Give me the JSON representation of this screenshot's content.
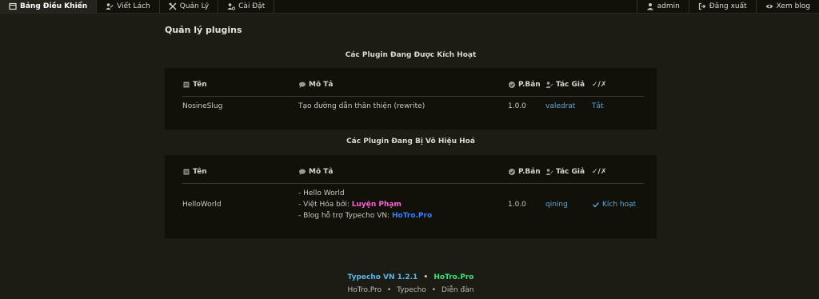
{
  "nav": {
    "left": [
      {
        "label": "Bảng Điều Khiển",
        "icon": "dashboard-icon"
      },
      {
        "label": "Viết Lách",
        "icon": "users-icon"
      },
      {
        "label": "Quản Lý",
        "icon": "tools-icon"
      },
      {
        "label": "Cài Đặt",
        "icon": "user-gear-icon"
      }
    ],
    "right": [
      {
        "label": "admin",
        "icon": "user-icon"
      },
      {
        "label": "Đăng xuất",
        "icon": "logout-icon"
      },
      {
        "label": "Xem blog",
        "icon": "eye-icon"
      }
    ]
  },
  "page_title": "Quản lý plugins",
  "columns": {
    "name": "Tên",
    "desc": "Mô Tả",
    "version": "P.Bản",
    "author": "Tác Giả",
    "action": "✓/✗"
  },
  "active": {
    "title": "Các Plugin Đang Được Kích Hoạt",
    "rows": [
      {
        "name": "NosineSlug",
        "desc": "Tạo đường dẫn thân thiện (rewrite)",
        "version": "1.0.0",
        "author": "valedrat",
        "action": "Tắt"
      }
    ]
  },
  "inactive": {
    "title": "Các Plugin Đang Bị Vô Hiệu Hoá",
    "rows": [
      {
        "name": "HelloWorld",
        "desc_line1": "- Hello World",
        "desc_line2_prefix": "- Việt Hóa bởi: ",
        "desc_line2_highlight": "Luyện Phạm",
        "desc_line3_prefix": "- Blog hỗ trợ Typecho VN: ",
        "desc_line3_highlight": "HoTro.Pro",
        "version": "1.0.0",
        "author": "qining",
        "action": "Kích hoạt"
      }
    ]
  },
  "footer": {
    "line1_a": "Typecho VN 1.2.1",
    "line1_sep": "•",
    "line1_b": "HoTro.Pro",
    "links": [
      "HoTro.Pro",
      "Typecho",
      "Diễn đàn"
    ],
    "link_sep": "•"
  },
  "colors": {
    "background": "#1c1c14",
    "panel": "#111109",
    "link": "#5fa8d8",
    "highlight_pink": "#ff5fd7",
    "highlight_blue": "#3a7dff",
    "highlight_green": "#3ce07a"
  }
}
